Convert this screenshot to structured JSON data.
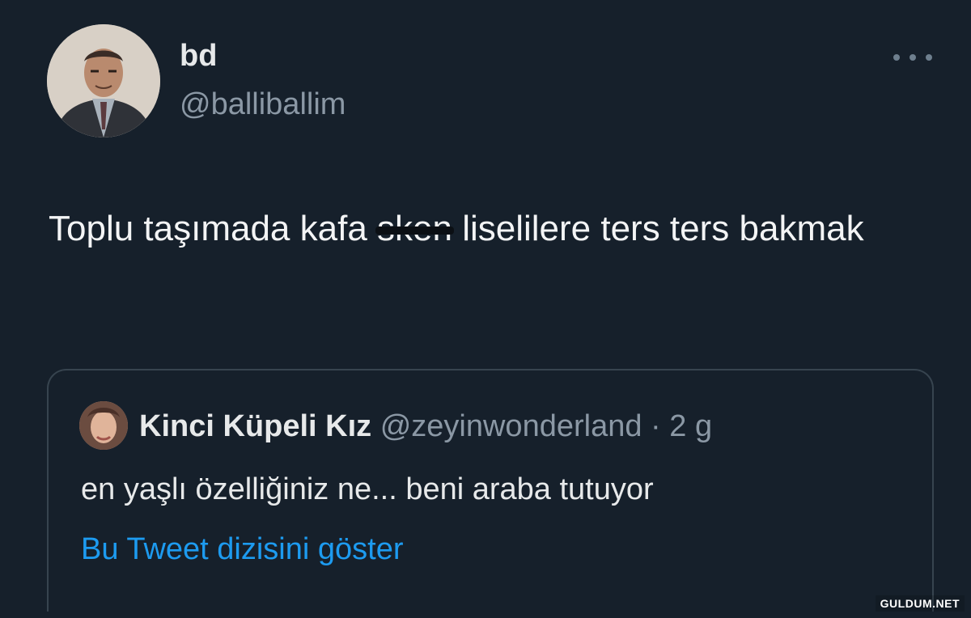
{
  "tweet": {
    "display_name": "bd",
    "handle": "@balliballim",
    "text_before": "Toplu taşımada kafa ",
    "text_struck": "sken",
    "text_after": " liselilere ters ters bakmak"
  },
  "quote": {
    "display_name": "Kinci Küpeli Kız",
    "handle": "@zeyinwonderland",
    "separator": " · ",
    "time": "2 g",
    "text": "en yaşlı özelliğiniz ne... beni araba tutuyor",
    "show_thread": "Bu Tweet dizisini göster"
  },
  "watermark": "GULDUM.NET",
  "icons": {
    "more": "more-dots-icon",
    "avatar": "profile-avatar",
    "quote_avatar": "quoted-profile-avatar"
  },
  "colors": {
    "background": "#16202b",
    "primary_text": "#e7e9ea",
    "secondary_text": "#8b98a5",
    "link": "#1d9bf0",
    "border": "#37444f"
  }
}
